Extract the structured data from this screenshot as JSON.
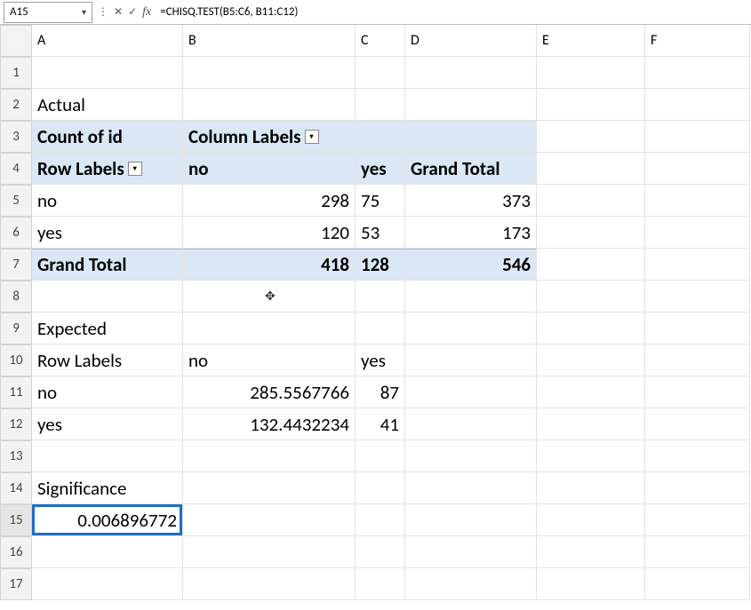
{
  "name_box": "A15",
  "formula": "=CHISQ.TEST(B5:C6, B11:C12)",
  "col_headers": [
    "A",
    "B",
    "C",
    "D",
    "E",
    "F"
  ],
  "row_headers": [
    "1",
    "2",
    "3",
    "4",
    "5",
    "6",
    "7",
    "8",
    "9",
    "10",
    "11",
    "12",
    "13",
    "14",
    "15",
    "16",
    "17"
  ],
  "cells": {
    "A2": "Actual",
    "A3": "Count of id",
    "B3": "Column Labels",
    "A4": "Row Labels",
    "B4": "no",
    "C4": "yes",
    "D4": "Grand Total",
    "A5": "no",
    "B5": "298",
    "C5": "75",
    "D5": "373",
    "A6": "yes",
    "B6": "120",
    "C6": "53",
    "D6": "173",
    "A7": "Grand Total",
    "B7": "418",
    "C7": "128",
    "D7": "546",
    "A9": "Expected",
    "A10": "Row Labels",
    "B10": "no",
    "C10": "yes",
    "A11": "no",
    "B11": "285.5567766",
    "C11": "87",
    "A12": "yes",
    "B12": "132.4432234",
    "C12": "41",
    "A14": "Significance",
    "A15": "0.006896772"
  },
  "icons": {
    "dots": "⋮",
    "cancel": "✕",
    "check": "✓"
  }
}
